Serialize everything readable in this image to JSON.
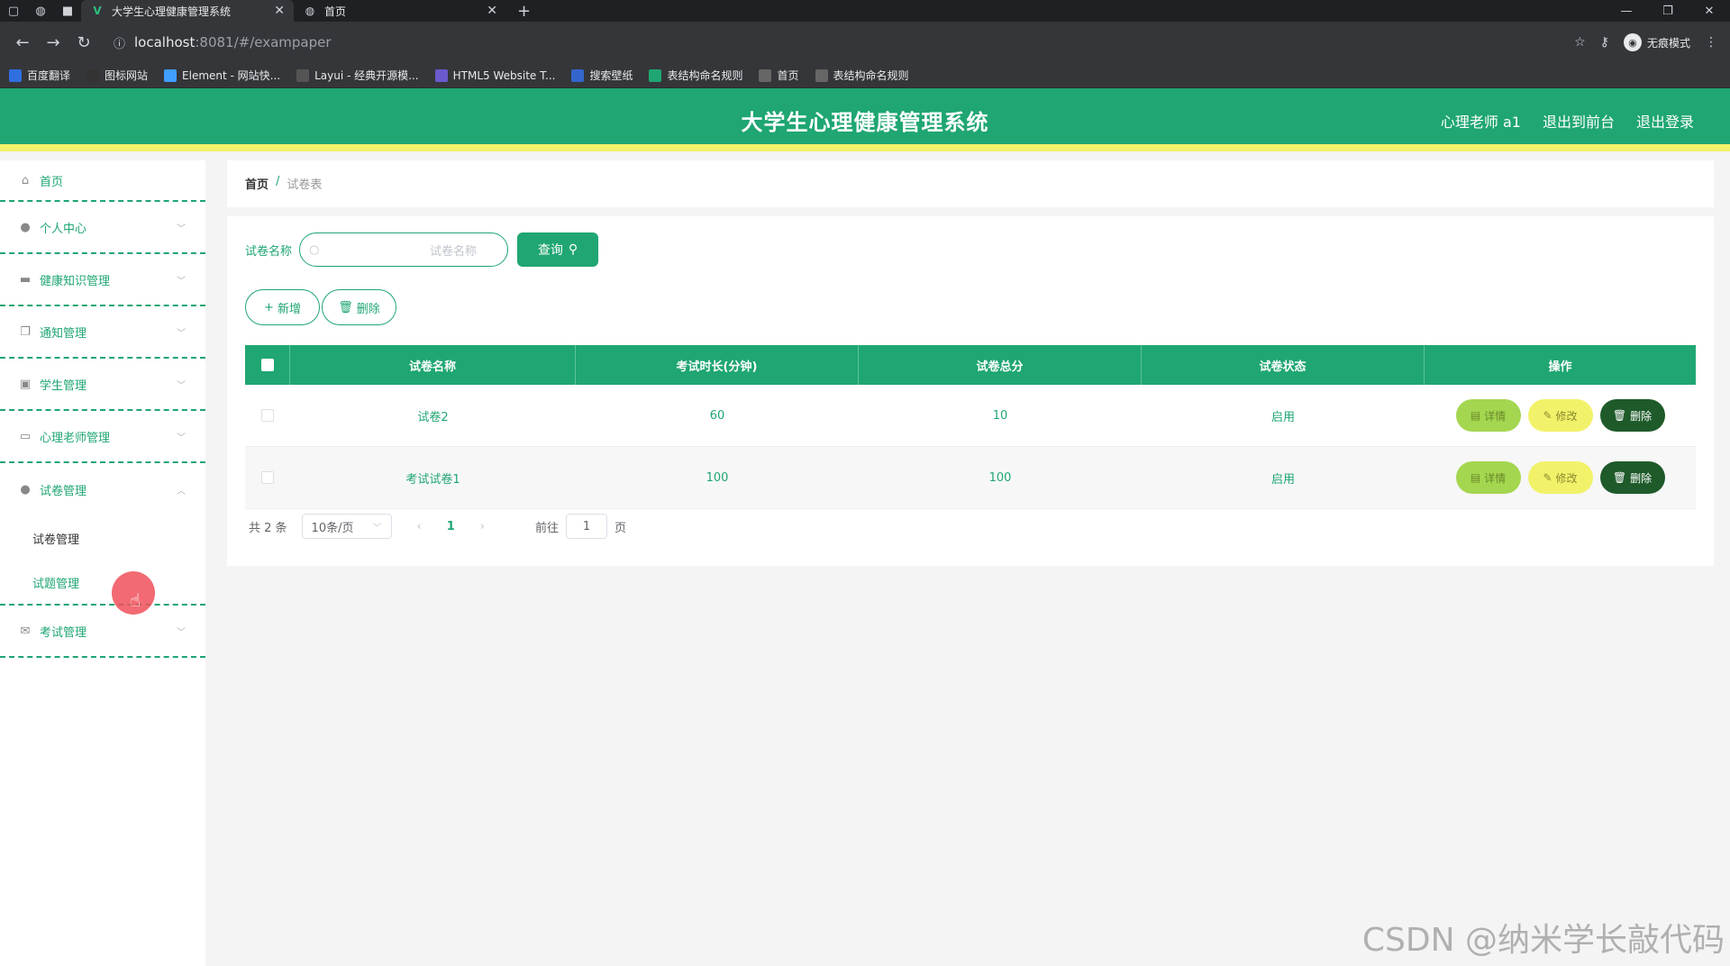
{
  "browser": {
    "tabs": [
      {
        "title": "大学生心理健康管理系统",
        "active": true
      },
      {
        "title": "首页",
        "active": false
      }
    ],
    "url_host": "localhost",
    "url_path": ":8081/#/exampaper",
    "profile_label": "无痕模式",
    "bookmarks": [
      {
        "label": "百度翻译",
        "color": "#2f6fdf"
      },
      {
        "label": "图标网站",
        "color": "#333333"
      },
      {
        "label": "Element - 网站快...",
        "color": "#409eff"
      },
      {
        "label": "Layui - 经典开源模...",
        "color": "#555555"
      },
      {
        "label": "HTML5 Website T...",
        "color": "#6a5acd"
      },
      {
        "label": "搜索壁纸",
        "color": "#3366cc"
      },
      {
        "label": "表结构命名规则",
        "color": "#1fa672"
      },
      {
        "label": "首页",
        "color": "#666666"
      },
      {
        "label": "表结构命名规则",
        "color": "#666666"
      }
    ]
  },
  "header": {
    "title": "大学生心理健康管理系统",
    "user": "心理老师 a1",
    "to_front": "退出到前台",
    "logout": "退出登录",
    "accent": "#1fa672",
    "stripe": "#f2f26a"
  },
  "sidebar": {
    "items": [
      {
        "label": "首页",
        "icon": "home-icon"
      },
      {
        "label": "个人中心",
        "icon": "user-icon"
      },
      {
        "label": "健康知识管理",
        "icon": "monitor-icon"
      },
      {
        "label": "通知管理",
        "icon": "copy-icon"
      },
      {
        "label": "学生管理",
        "icon": "clipboard-icon"
      },
      {
        "label": "心理老师管理",
        "icon": "chat-icon"
      },
      {
        "label": "试卷管理",
        "icon": "user-icon"
      },
      {
        "label": "考试管理",
        "icon": "mail-icon"
      }
    ],
    "submenu": [
      "试卷管理",
      "试题管理"
    ]
  },
  "breadcrumb": {
    "home": "首页",
    "sep": "/",
    "current": "试卷表"
  },
  "search": {
    "label": "试卷名称",
    "placeholder": "试卷名称",
    "button": "查询"
  },
  "actions": {
    "add": "新增",
    "delete": "删除"
  },
  "table": {
    "columns": [
      "试卷名称",
      "考试时长(分钟)",
      "试卷总分",
      "试卷状态",
      "操作"
    ],
    "rows": [
      {
        "name": "试卷2",
        "duration": "60",
        "score": "10",
        "status": "启用"
      },
      {
        "name": "考试试卷1",
        "duration": "100",
        "score": "100",
        "status": "启用"
      }
    ],
    "ops": {
      "detail": "详情",
      "edit": "修改",
      "delete": "删除"
    }
  },
  "pager": {
    "total": "共 2 条",
    "size": "10条/页",
    "page": "1",
    "goto_prefix": "前往",
    "goto_value": "1",
    "goto_suffix": "页"
  },
  "watermark": "CSDN @纳米学长敲代码"
}
